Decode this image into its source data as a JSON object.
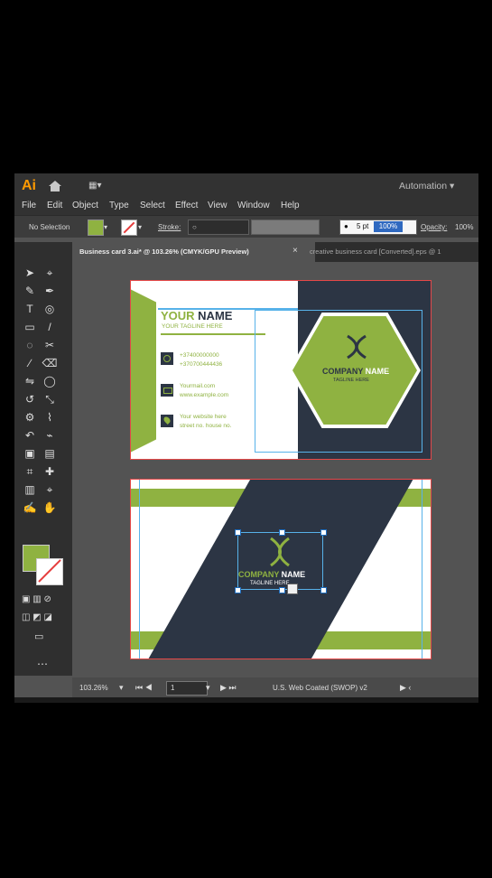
{
  "app": {
    "logo": "Ai",
    "workspace": "Automation",
    "menu": [
      "File",
      "Edit",
      "Object",
      "Type",
      "Select",
      "Effect",
      "View",
      "Window",
      "Help"
    ],
    "control": {
      "selection": "No Selection",
      "stroke_label": "Stroke:",
      "stroke_value": "○",
      "brush": "●",
      "pt": "5 pt",
      "brush_zoom": "100%",
      "opacity_label": "Opacity:",
      "opacity_value": "100%"
    },
    "tabs": [
      "Business card 3.ai* @ 103.26% (CMYK/GPU Preview)",
      "creative business card [Converted].eps @ 1"
    ],
    "status": {
      "zoom": "103.26%",
      "artboard": "1",
      "color_profile": "U.S. Web Coated (SWOP) v2"
    },
    "colors": {
      "green": "#8fb241",
      "navy": "#2c3544",
      "panel": "#535353",
      "dark": "#323232"
    },
    "icons": [
      "home-icon",
      "workspace-icon",
      "close-icon",
      "selection-tool-icon",
      "pen-tool-icon",
      "type-tool-icon",
      "rectangle-tool-icon",
      "hand-tool-icon"
    ]
  },
  "card_front": {
    "name": "YOUR NAME",
    "tagline": "YOUR TAGLINE HERE",
    "phone1": "+37400000000",
    "phone2": "+370700444436",
    "email1": "Yourmail.com",
    "email2": "www.example.com",
    "web1": "Your website here",
    "web2": "street no. house no.",
    "company": "COMPANY NAME",
    "tagline2": "TAGLINE HERE"
  },
  "card_back": {
    "company": "COMPANY NAME",
    "tagline": "TAGLINE HERE"
  }
}
